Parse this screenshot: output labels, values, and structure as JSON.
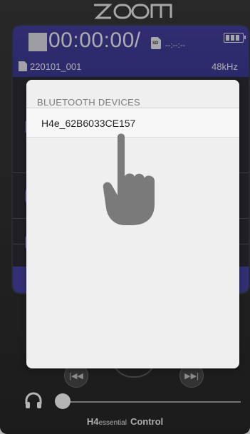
{
  "app": {
    "logo_text": "ZOOM",
    "brand_model": "H4",
    "brand_edition": "essential",
    "brand_app": "Control"
  },
  "recorder": {
    "elapsed_time": "00:00:00",
    "separator": "/",
    "remaining_time": "--:--:--",
    "storage_label": "SD",
    "filename": "220101_001",
    "sample_rate": "48kHz"
  },
  "bluetooth_dialog": {
    "title": "BLUETOOTH DEVICES",
    "devices": [
      {
        "name": "H4e_62B6033CE157"
      }
    ]
  },
  "icons": {
    "battery": "battery-icon",
    "sd_card": "sd-card-icon",
    "file": "file-icon",
    "stop": "stop-icon",
    "rewind": "rewind-icon",
    "fast_forward": "fast-forward-icon",
    "headphones": "headphones-icon",
    "tap_hint": "tap-hand-icon"
  },
  "colors": {
    "status_bar": "#221e86",
    "dialog_bg": "#efefef",
    "body_bg": "#111111"
  }
}
